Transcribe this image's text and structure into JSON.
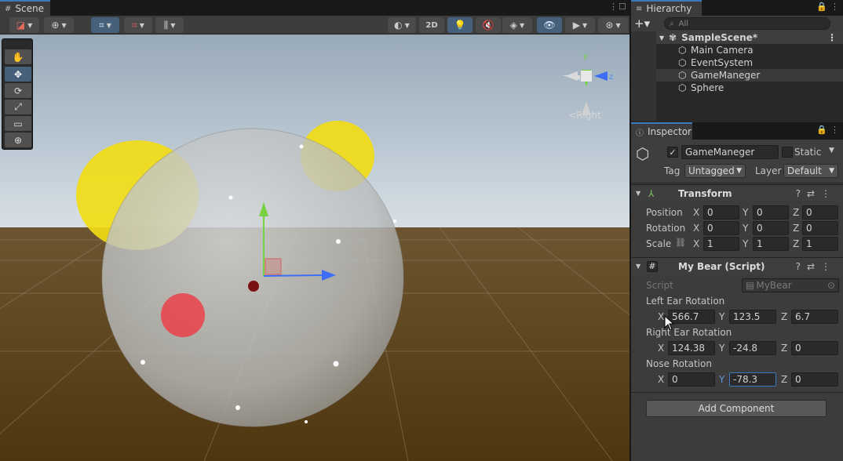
{
  "scene_panel": {
    "tab_label": "Scene",
    "toolbar": {
      "btn_2d": "2D"
    },
    "gizmo": {
      "y_label": "y",
      "z_label": "z",
      "view_label": "Right"
    }
  },
  "hierarchy": {
    "tab_label": "Hierarchy",
    "search_placeholder": "All",
    "items": [
      {
        "label": "SampleScene*"
      },
      {
        "label": "Main Camera"
      },
      {
        "label": "EventSystem"
      },
      {
        "label": "GameManeger"
      },
      {
        "label": "Sphere"
      }
    ]
  },
  "inspector": {
    "tab_label": "Inspector",
    "object_name": "GameManeger",
    "static_label": "Static",
    "tag_label": "Tag",
    "tag_value": "Untagged",
    "layer_label": "Layer",
    "layer_value": "Default",
    "transform": {
      "title": "Transform",
      "position_label": "Position",
      "rotation_label": "Rotation",
      "scale_label": "Scale",
      "position": {
        "x": "0",
        "y": "0",
        "z": "0"
      },
      "rotation": {
        "x": "0",
        "y": "0",
        "z": "0"
      },
      "scale": {
        "x": "1",
        "y": "1",
        "z": "1"
      }
    },
    "my_bear": {
      "title": "My Bear (Script)",
      "script_label": "Script",
      "script_value": "MyBear",
      "left_ear_label": "Left Ear Rotation",
      "left_ear": {
        "x": "566.7",
        "y": "123.5",
        "z": "6.7"
      },
      "right_ear_label": "Right Ear Rotation",
      "right_ear": {
        "x": "124.38",
        "y": "-24.8",
        "z": "0"
      },
      "nose_label": "Nose Rotation",
      "nose": {
        "x": "0",
        "y": "-78.3",
        "z": "0"
      }
    },
    "add_component": "Add Component",
    "axis_x": "X",
    "axis_y": "Y",
    "axis_z": "Z"
  },
  "colors": {
    "accent": "#3a79bb",
    "ear_yellow": "#f1dc16",
    "nose_red": "#e8474f",
    "ground": "#5a4019",
    "sky": "#c8d6e3"
  }
}
